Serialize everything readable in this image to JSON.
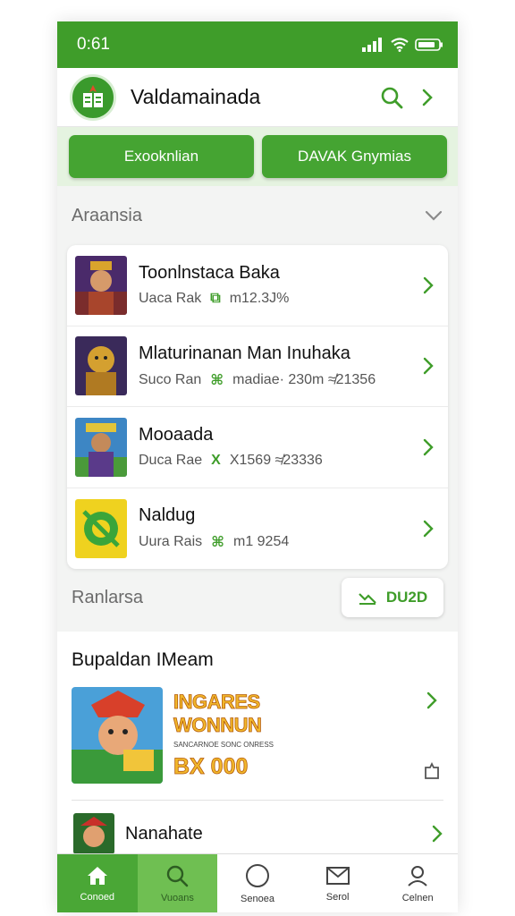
{
  "status": {
    "time": "0:61"
  },
  "header": {
    "title": "Valdamainada"
  },
  "buttons": {
    "left": "Exooknlian",
    "right": "DAVAK Gnymias"
  },
  "section1": {
    "title": "Araansia"
  },
  "list": [
    {
      "title": "Toonlnstaca Baka",
      "meta1": "Uaca Rak",
      "meta_icon": "⧉",
      "meta2": "m12.3J%"
    },
    {
      "title": "Mlaturinanan Man Inuhaka",
      "meta1": "Suco Ran",
      "meta_icon": "⌘",
      "meta2": "madiae· 230m ≉21356"
    },
    {
      "title": "Mooaada",
      "meta1": "Duca Rae",
      "meta_icon": "X",
      "meta2": "X1569 ≉23336"
    },
    {
      "title": "Naldug",
      "meta1": "Uura Rais",
      "meta_icon": "⌘",
      "meta2": "m1 9254"
    }
  ],
  "section2": {
    "title": "Ranlarsa",
    "pill_label": "DU2D"
  },
  "feature": {
    "title": "Bupaldan IMeam",
    "promo_line1": "INGARES",
    "promo_line2": "WONNUN",
    "promo_small": "SANCARNOE SONC ONRESS",
    "promo_price": "BX 000",
    "second_item": "Nanahate"
  },
  "tabs": [
    {
      "label": "Conoed",
      "icon": "home-icon"
    },
    {
      "label": "Vuoans",
      "icon": "search-icon"
    },
    {
      "label": "Senoea",
      "icon": "circle-icon"
    },
    {
      "label": "Serol",
      "icon": "mail-icon"
    },
    {
      "label": "Celnen",
      "icon": "profile-icon"
    }
  ],
  "colors": {
    "primary": "#3f9d2a",
    "accent": "#45a432",
    "promo_gold": "#f1b72b"
  }
}
